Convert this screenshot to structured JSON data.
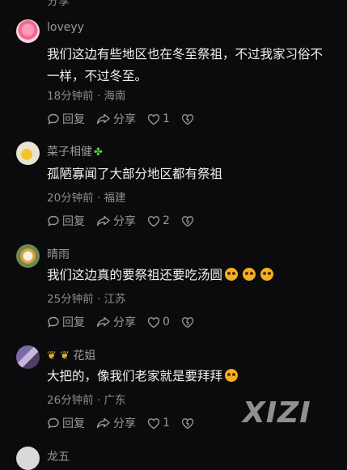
{
  "top_partial": {
    "share_label": "分享"
  },
  "comments": [
    {
      "username": "loveyy",
      "text": "我们这边有些地区也在冬至祭祖，不过我家习俗不一样，不过冬至。",
      "meta": "18分钟前 · 海南",
      "reply_label": "回复",
      "share_label": "分享",
      "like_count": "1"
    },
    {
      "username": "菜子相健",
      "text": "孤陋寡闻了大部分地区都有祭祖",
      "meta": "20分钟前 · 福建",
      "reply_label": "回复",
      "share_label": "分享",
      "like_count": "2"
    },
    {
      "username": "晴雨",
      "text": "我们这边真的要祭祖还要吃汤圆",
      "meta": "25分钟前 · 江苏",
      "reply_label": "回复",
      "share_label": "分享",
      "like_count": "0"
    },
    {
      "username": "花姐",
      "text": "大把的，像我们老家就是要拜拜",
      "meta": "26分钟前 · 广东",
      "reply_label": "回复",
      "share_label": "分享",
      "like_count": "1"
    },
    {
      "username": "龙五"
    }
  ],
  "watermark": "XIZI",
  "colors": {
    "background": "#0b0b0d",
    "text": "#f0f0f0",
    "muted": "#8d8d8d"
  }
}
